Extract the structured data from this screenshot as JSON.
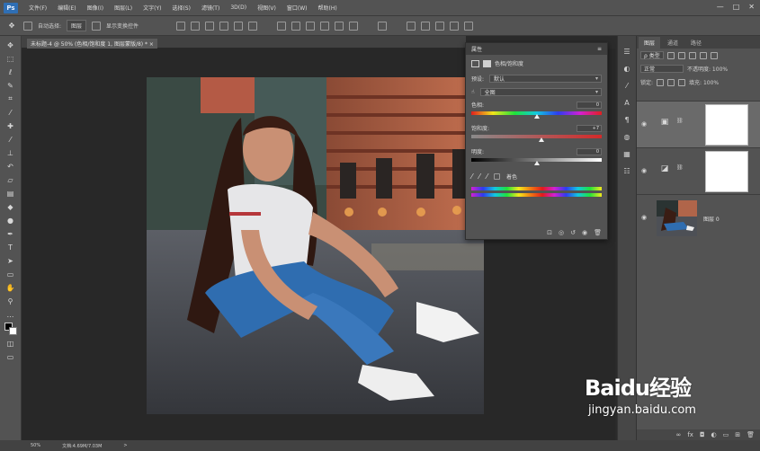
{
  "menu": [
    "文件(F)",
    "编辑(E)",
    "图像(I)",
    "图层(L)",
    "文字(Y)",
    "选择(S)",
    "滤镜(T)",
    "3D(D)",
    "视图(V)",
    "窗口(W)",
    "帮助(H)"
  ],
  "window_controls": [
    "—",
    "□",
    "✕"
  ],
  "options": {
    "auto_select": "自动选择:",
    "auto_target": "图层",
    "show_transform": "显示变换控件"
  },
  "doc_tab": {
    "label": "未标题-4 @ 50% (色相/饱和度 1, 图层蒙版/8) *  ×"
  },
  "properties": {
    "tab": "属性",
    "title": "色相/饱和度",
    "preset_label": "预设:",
    "preset_value": "默认",
    "channel_value": "全图",
    "hue_label": "色相:",
    "hue_value": "0",
    "hue_frac": 0.5,
    "sat_label": "饱和度:",
    "sat_value": "+7",
    "sat_frac": 0.535,
    "light_label": "明度:",
    "light_value": "0",
    "light_frac": 0.5,
    "colorize_label": "着色"
  },
  "layers": {
    "tabs": [
      "图层",
      "通道",
      "路径"
    ],
    "kind": "ρ 类型",
    "blend": "正常",
    "opacity": "不透明度: 100%",
    "lock": "锁定:",
    "fill": "填充: 100%",
    "items": [
      {
        "name": "",
        "type": "adjustment-hue"
      },
      {
        "name": "",
        "type": "adjustment-levels"
      },
      {
        "name": "图层 0",
        "type": "photo"
      }
    ]
  },
  "status": {
    "zoom": "50%",
    "doc": "文档:4.69M/7.03M",
    "arrow": ">"
  },
  "watermark": {
    "brand": "Baidu经验",
    "url": "jingyan.baidu.com"
  }
}
